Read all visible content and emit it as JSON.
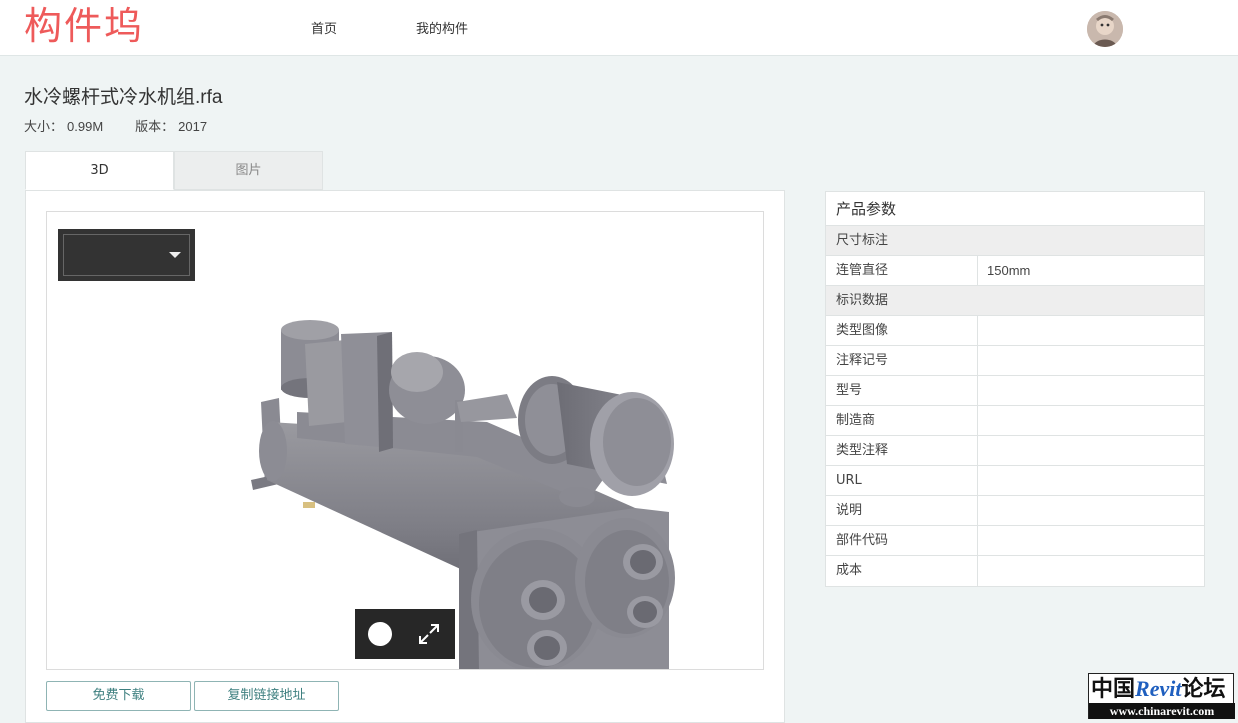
{
  "header": {
    "logo": "构件坞",
    "nav": {
      "home": "首页",
      "my_components": "我的构件"
    }
  },
  "file": {
    "title": "水冷螺杆式冷水机组.rfa",
    "size_label": "大小：",
    "size_value": "0.99M",
    "version_label": "版本：",
    "version_value": "2017"
  },
  "tabs": [
    {
      "label": "3D",
      "active": true
    },
    {
      "label": "图片",
      "active": false
    }
  ],
  "viewer": {
    "dropdown_value": ""
  },
  "actions": {
    "download": "免费下载",
    "copy_link": "复制链接地址"
  },
  "params": {
    "title": "产品参数",
    "groups": [
      {
        "name": "尺寸标注",
        "rows": [
          {
            "key": "连管直径",
            "value": "150mm"
          }
        ]
      },
      {
        "name": "标识数据",
        "rows": [
          {
            "key": "类型图像",
            "value": ""
          },
          {
            "key": "注释记号",
            "value": ""
          },
          {
            "key": "型号",
            "value": ""
          },
          {
            "key": "制造商",
            "value": ""
          },
          {
            "key": "类型注释",
            "value": ""
          },
          {
            "key": "URL",
            "value": ""
          },
          {
            "key": "说明",
            "value": ""
          },
          {
            "key": "部件代码",
            "value": ""
          },
          {
            "key": "成本",
            "value": ""
          }
        ]
      }
    ]
  },
  "watermark": {
    "line1_cn_a": "中国",
    "line1_en": "Revit",
    "line1_cn_b": "论坛",
    "line2": "www.chinarevit.com"
  },
  "colors": {
    "logo": "#ee5a5a",
    "accent": "#3d7f7f",
    "page_bg": "#eff4f4"
  }
}
